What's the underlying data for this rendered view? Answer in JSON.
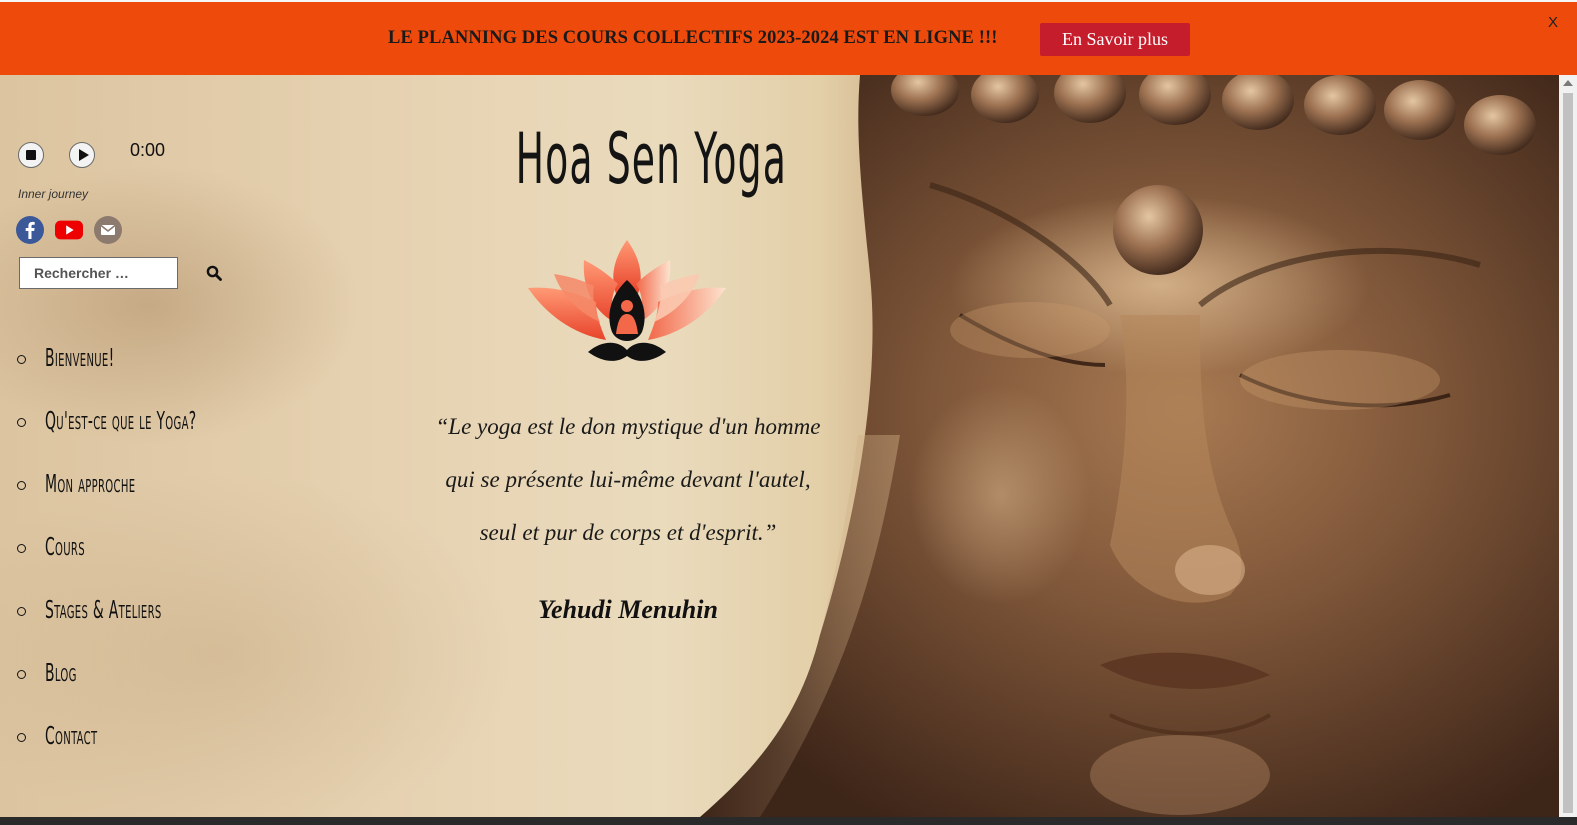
{
  "banner": {
    "text": "LE PLANNING DES COURS COLLECTIFS 2023-2024 EST EN LIGNE !!!",
    "button_label": "En Savoir plus",
    "close_label": "X"
  },
  "player": {
    "time": "0:00",
    "track": "Inner journey"
  },
  "social": [
    "facebook-icon",
    "youtube-icon",
    "email-icon"
  ],
  "search": {
    "placeholder": "Rechercher …"
  },
  "nav": [
    "Bienvenue!",
    "Qu'est-ce que le Yoga?",
    "Mon approche",
    "Cours",
    "Stages & Ateliers",
    "Blog",
    "Contact"
  ],
  "hero": {
    "site_title": "Hoa Sen Yoga",
    "quote_lines": [
      "“Le yoga est le don mystique d'un homme",
      "qui se présente lui-même devant l'autel,",
      "seul et pur de corps et d'esprit.”"
    ],
    "author": "Yehudi Menuhin"
  },
  "colors": {
    "banner": "#ee4a0b",
    "banner_button": "#c61d2c",
    "lotus": "#f06b4a"
  }
}
